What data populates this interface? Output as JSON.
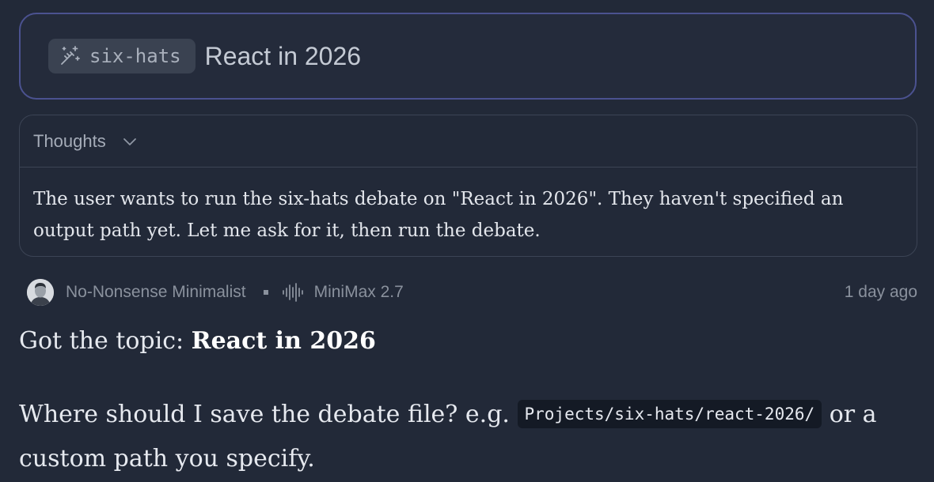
{
  "prompt": {
    "skill_chip": "six-hats",
    "skill_icon": "magic-wand-icon",
    "text": "React in 2026"
  },
  "thoughts": {
    "label": "Thoughts",
    "body": "The user wants to run the six-hats debate on \"React in 2026\". They haven't specified an output path yet. Let me ask for it, then run the debate."
  },
  "message": {
    "author": "No-Nonsense Minimalist",
    "model": "MiniMax 2.7",
    "timestamp": "1 day ago",
    "topic_prefix": "Got the topic: ",
    "topic": "React in 2026",
    "question_prefix": "Where should I save the debate file? e.g. ",
    "example_path": "Projects/six-hats/react-2026/",
    "question_suffix": " or a custom path you specify."
  },
  "colors": {
    "background": "#222938",
    "prompt_border": "#4b5290",
    "chip_background": "#3a4251",
    "code_background": "#141a25"
  }
}
